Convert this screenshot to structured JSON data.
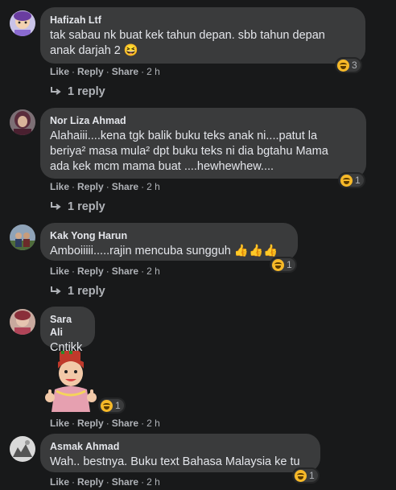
{
  "comments": [
    {
      "author": "Hafizah Ltf",
      "text": "tak sabau nk buat kek tahun depan. sbb tahun depan\nanak darjah 2 😆",
      "actions": {
        "like": "Like",
        "reply": "Reply",
        "share": "Share",
        "time": "2 h"
      },
      "reaction_count": "3",
      "replies": "1 reply"
    },
    {
      "author": "Nor Liza Ahmad",
      "text": "Alahaiii....kena tgk balik buku teks anak ni....patut la\nberiya² masa mula² dpt buku teks ni dia bgtahu Mama\nada kek mcm mama buat ....hewhewhew....",
      "actions": {
        "like": "Like",
        "reply": "Reply",
        "share": "Share",
        "time": "2 h"
      },
      "reaction_count": "1",
      "replies": "1 reply"
    },
    {
      "author": "Kak Yong Harun",
      "text": "Amboiiiii.....rajin mencuba sungguh 👍👍👍",
      "actions": {
        "like": "Like",
        "reply": "Reply",
        "share": "Share",
        "time": "2 h"
      },
      "reaction_count": "1",
      "replies": "1 reply"
    },
    {
      "author": "Sara Ali",
      "text": "Cntikk",
      "actions": {
        "like": "Like",
        "reply": "Reply",
        "share": "Share",
        "time": "2 h"
      },
      "reaction_count": "1"
    },
    {
      "author": "Asmak Ahmad",
      "text": "Wah.. bestnya. Buku text Bahasa Malaysia ke tu",
      "actions": {
        "like": "Like",
        "reply": "Reply",
        "share": "Share",
        "time": "2 h"
      },
      "reaction_count": "1"
    }
  ],
  "colors": {
    "background": "#18191a",
    "bubble": "#3a3b3c",
    "text": "#e4e6eb",
    "secondary": "#b0b3b8",
    "haha": "#f7b928"
  }
}
